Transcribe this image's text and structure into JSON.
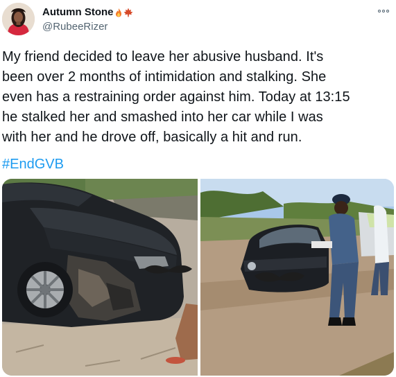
{
  "tweet": {
    "author": {
      "display_name": "Autumn Stone",
      "handle": "@RubeeRizer",
      "avatar_icon": "profile-photo",
      "name_emojis": [
        "fire",
        "maple-leaf"
      ]
    },
    "menu_icon": "more-icon",
    "text_lines": [
      "My friend decided to leave her abusive husband. It's",
      "been over 2 months of intimidation and stalking. She",
      "even has a restraining order against him. Today at 13:15",
      "he stalked her and smashed into her car while I was",
      "with her and he drove off, basically a hit and run."
    ],
    "hashtag": "#EndGVB",
    "colors": {
      "text": "#0f1419",
      "secondary": "#536471",
      "link": "#1d9bf0"
    }
  }
}
